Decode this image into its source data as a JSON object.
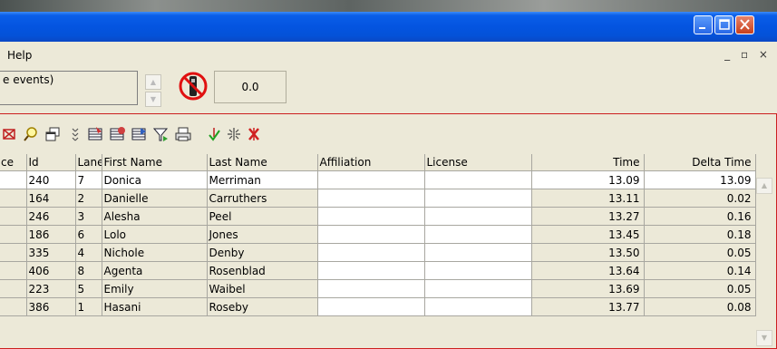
{
  "menu": {
    "help": "Help",
    "mdi_controls": "_ ▫ ×"
  },
  "info": {
    "events_text": "e events)",
    "time_value": "0.0"
  },
  "toolbar": {
    "icons": [
      "delete-record-icon",
      "find-icon",
      "windows-icon",
      "sort-icon",
      "import-icon",
      "export-icon",
      "heat-icon",
      "filter-icon",
      "print-icon",
      "check-arrow-icon",
      "split-icon",
      "clear-icon"
    ]
  },
  "grid": {
    "headers": [
      "ce",
      "Id",
      "Lane",
      "First Name",
      "Last Name",
      "Affiliation",
      "License",
      "Time",
      "Delta Time"
    ],
    "rows": [
      {
        "place": "",
        "id": "240",
        "lane": "7",
        "first": "Donica",
        "last": "Merriman",
        "affil": "",
        "license": "",
        "time": "13.09",
        "delta": "13.09"
      },
      {
        "place": "",
        "id": "164",
        "lane": "2",
        "first": "Danielle",
        "last": "Carruthers",
        "affil": "",
        "license": "",
        "time": "13.11",
        "delta": "0.02"
      },
      {
        "place": "",
        "id": "246",
        "lane": "3",
        "first": "Alesha",
        "last": "Peel",
        "affil": "",
        "license": "",
        "time": "13.27",
        "delta": "0.16"
      },
      {
        "place": "",
        "id": "186",
        "lane": "6",
        "first": "Lolo",
        "last": "Jones",
        "affil": "",
        "license": "",
        "time": "13.45",
        "delta": "0.18"
      },
      {
        "place": "",
        "id": "335",
        "lane": "4",
        "first": "Nichole",
        "last": "Denby",
        "affil": "",
        "license": "",
        "time": "13.50",
        "delta": "0.05"
      },
      {
        "place": "",
        "id": "406",
        "lane": "8",
        "first": "Agenta",
        "last": "Rosenblad",
        "affil": "",
        "license": "",
        "time": "13.64",
        "delta": "0.14"
      },
      {
        "place": "",
        "id": "223",
        "lane": "5",
        "first": "Emily",
        "last": "Waibel",
        "affil": "",
        "license": "",
        "time": "13.69",
        "delta": "0.05"
      },
      {
        "place": "",
        "id": "386",
        "lane": "1",
        "first": "Hasani",
        "last": "Roseby",
        "affil": "",
        "license": "",
        "time": "13.77",
        "delta": "0.08"
      }
    ]
  }
}
